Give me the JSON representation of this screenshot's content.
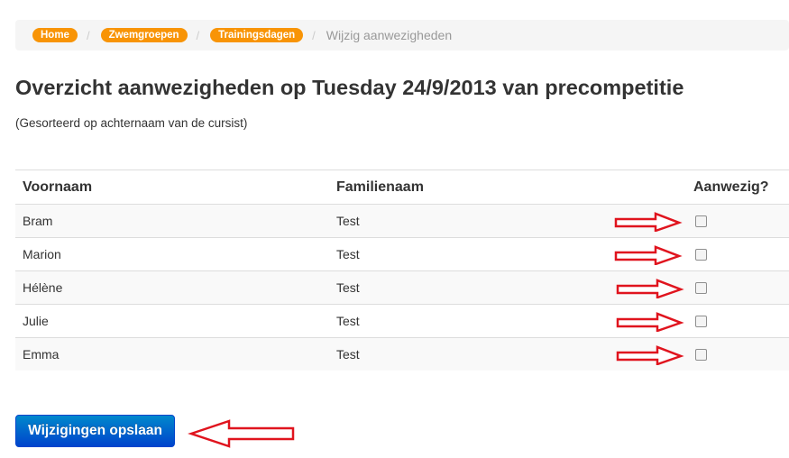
{
  "breadcrumb": {
    "items": [
      {
        "label": "Home"
      },
      {
        "label": "Zwemgroepen"
      },
      {
        "label": "Trainingsdagen"
      }
    ],
    "separator": "/",
    "active": "Wijzig aanwezigheden"
  },
  "page": {
    "title": "Overzicht aanwezigheden op Tuesday 24/9/2013 van precompetitie",
    "subtitle": "(Gesorteerd op achternaam van de cursist)"
  },
  "table": {
    "headers": {
      "first": "Voornaam",
      "last": "Familienaam",
      "present": "Aanwezig?"
    },
    "rows": [
      {
        "first": "Bram",
        "last": "Test",
        "present": false
      },
      {
        "first": "Marion",
        "last": "Test",
        "present": false
      },
      {
        "first": "Hélène",
        "last": "Test",
        "present": false
      },
      {
        "first": "Julie",
        "last": "Test",
        "present": false
      },
      {
        "first": "Emma",
        "last": "Test",
        "present": false
      }
    ]
  },
  "actions": {
    "save_label": "Wijzigingen opslaan"
  },
  "colors": {
    "badge": "#f89406",
    "primary": "#0044cc",
    "annotation": "#e0141e"
  },
  "annotations": {
    "icon": "red-outline-arrow-icon"
  }
}
